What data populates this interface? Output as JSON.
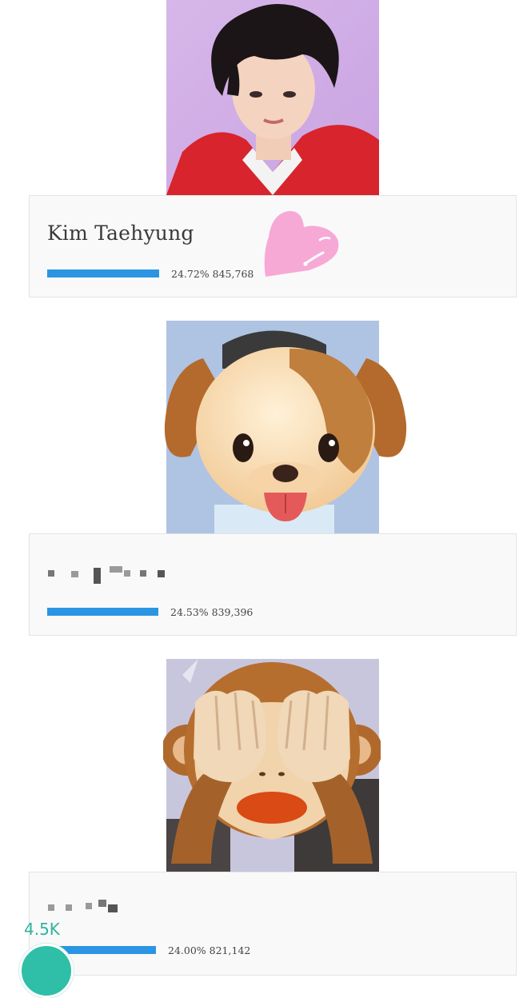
{
  "entries": [
    {
      "name": "Kim Taehyung",
      "percent": "24.72%",
      "votes": "845,768",
      "fraction": 0.2472,
      "photo": "portrait-photo"
    },
    {
      "name": "",
      "percent": "24.53%",
      "votes": "839,396",
      "fraction": 0.2453,
      "photo": "puppy-emoji-over-photo",
      "name_redacted": true
    },
    {
      "name": "",
      "percent": "24.00%",
      "votes": "821,142",
      "fraction": 0.24,
      "photo": "see-no-evil-monkey-emoji-over-photo",
      "name_redacted": true
    }
  ],
  "share": {
    "count": "4.5K",
    "icon": "share-icon"
  },
  "decoration": {
    "icon": "pink-heart-icon"
  },
  "colors": {
    "bar": "#2b95e3",
    "share": "#2fb3a0",
    "heart": "#f7a9d6"
  }
}
